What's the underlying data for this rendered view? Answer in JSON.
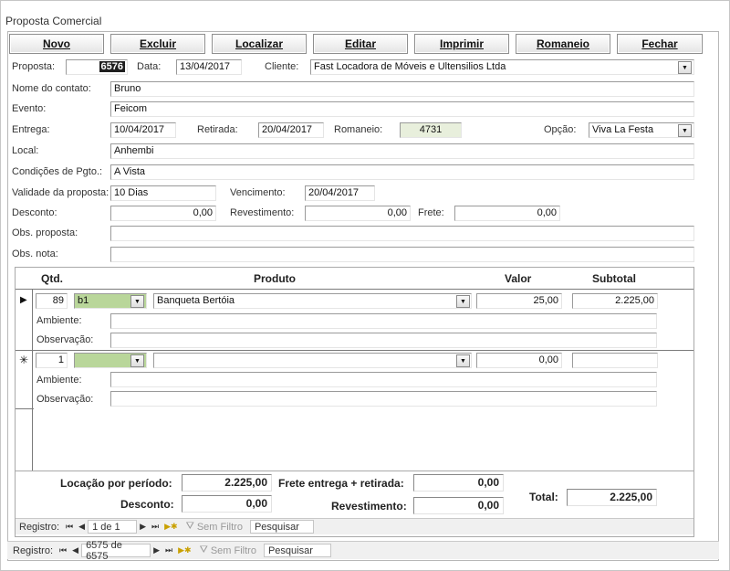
{
  "window": {
    "title": "Proposta Comercial"
  },
  "toolbar": {
    "novo": "Novo",
    "excluir": "Excluir",
    "localizar": "Localizar",
    "editar": "Editar",
    "imprimir": "Imprimir",
    "romaneio": "Romaneio",
    "fechar": "Fechar"
  },
  "form": {
    "proposta_label": "Proposta:",
    "proposta": "6576",
    "data_label": "Data:",
    "data": "13/04/2017",
    "cliente_label": "Cliente:",
    "cliente": "Fast Locadora de Móveis e Ultensilios Ltda",
    "contato_label": "Nome do contato:",
    "contato": "Bruno",
    "evento_label": "Evento:",
    "evento": "Feicom",
    "entrega_label": "Entrega:",
    "entrega": "10/04/2017",
    "retirada_label": "Retirada:",
    "retirada": "20/04/2017",
    "romaneio_label": "Romaneio:",
    "romaneio": "4731",
    "opcao_label": "Opção:",
    "opcao": "Viva La Festa",
    "local_label": "Local:",
    "local": "Anhembi",
    "condicoes_label": "Condições de Pgto.:",
    "condicoes": "A Vista",
    "validade_label": "Validade da proposta:",
    "validade": "10 Dias",
    "vencimento_label": "Vencimento:",
    "vencimento": "20/04/2017",
    "desconto_label": "Desconto:",
    "desconto": "0,00",
    "revestimento_label": "Revestimento:",
    "revestimento": "0,00",
    "frete_label": "Frete:",
    "frete": "0,00",
    "obs_proposta_label": "Obs. proposta:",
    "obs_proposta": "",
    "obs_nota_label": "Obs. nota:",
    "obs_nota": ""
  },
  "items": {
    "headers": {
      "qtd": "Qtd.",
      "produto": "Produto",
      "valor": "Valor",
      "subtotal": "Subtotal"
    },
    "rows": [
      {
        "qtd": "89",
        "codigo": "b1",
        "produto": "Banqueta Bertóia",
        "valor": "25,00",
        "subtotal": "2.225,00",
        "ambiente": "",
        "observacao": ""
      },
      {
        "qtd": "1",
        "codigo": "",
        "produto": "",
        "valor": "0,00",
        "subtotal": "",
        "ambiente": "",
        "observacao": ""
      }
    ],
    "ambiente_label": "Ambiente:",
    "observacao_label": "Observação:",
    "current_marker": "▶",
    "new_marker": "✳"
  },
  "totals": {
    "locacao_label": "Locação por período:",
    "locacao": "2.225,00",
    "frete_label": "Frete entrega + retirada:",
    "frete": "0,00",
    "desconto_label": "Desconto:",
    "desconto": "0,00",
    "revestimento_label": "Revestimento:",
    "revestimento": "0,00",
    "total_label": "Total:",
    "total": "2.225,00"
  },
  "subform_nav": {
    "label": "Registro:",
    "position": "1 de 1",
    "filter": "Sem Filtro",
    "search": "Pesquisar"
  },
  "main_nav": {
    "label": "Registro:",
    "position": "6575 de 6575",
    "filter": "Sem Filtro",
    "search": "Pesquisar"
  }
}
